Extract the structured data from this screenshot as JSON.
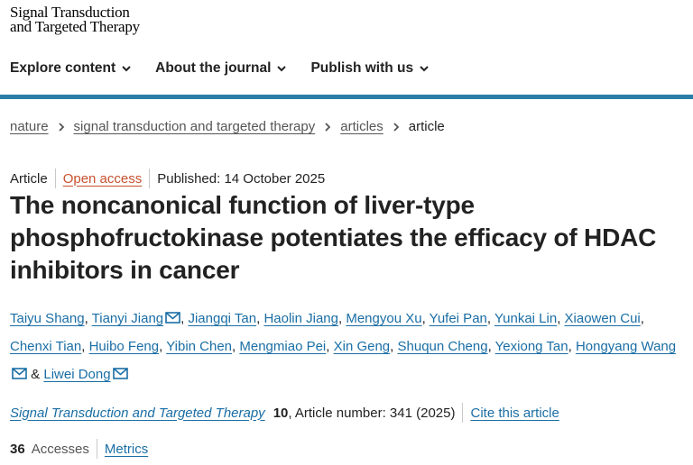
{
  "brand": {
    "line1": "Signal Transduction",
    "line2": "and Targeted Therapy"
  },
  "nav": [
    {
      "label": "Explore content"
    },
    {
      "label": "About the journal"
    },
    {
      "label": "Publish with us"
    }
  ],
  "breadcrumb": [
    {
      "label": "nature"
    },
    {
      "label": "signal transduction and targeted therapy"
    },
    {
      "label": "articles"
    },
    {
      "label": "article"
    }
  ],
  "meta": {
    "type": "Article",
    "access": "Open access",
    "published": "Published: 14 October 2025"
  },
  "title": "The noncanonical function of liver-type phosphofructokinase potentiates the efficacy of HDAC inhibitors in cancer",
  "authors": [
    {
      "name": "Taiyu Shang",
      "mail": false
    },
    {
      "name": "Tianyi Jiang",
      "mail": true
    },
    {
      "name": "Jiangqi Tan",
      "mail": false
    },
    {
      "name": "Haolin Jiang",
      "mail": false
    },
    {
      "name": "Mengyou Xu",
      "mail": false
    },
    {
      "name": "Yufei Pan",
      "mail": false
    },
    {
      "name": "Yunkai Lin",
      "mail": false
    },
    {
      "name": "Xiaowen Cui",
      "mail": false
    },
    {
      "name": "Chenxi Tian",
      "mail": false
    },
    {
      "name": "Huibo Feng",
      "mail": false
    },
    {
      "name": "Yibin Chen",
      "mail": false
    },
    {
      "name": "Mengmiao Pei",
      "mail": false
    },
    {
      "name": "Xin Geng",
      "mail": false
    },
    {
      "name": "Shuqun Cheng",
      "mail": false
    },
    {
      "name": "Yexiong Tan",
      "mail": false
    },
    {
      "name": "Hongyang Wang",
      "mail": true
    },
    {
      "name": "Liwei Dong",
      "mail": true
    }
  ],
  "author_separator": ",",
  "author_last_joiner": "&",
  "journal": {
    "name": "Signal Transduction and Targeted Therapy",
    "volume": "10",
    "article_number": ", Article number: 341 (2025)",
    "cite": "Cite this article"
  },
  "metrics": {
    "accesses_count": "36",
    "accesses_label": "Accesses",
    "metrics_link": "Metrics"
  },
  "colors": {
    "accent_bar": "#2a7fa8",
    "link": "#1a6ea5",
    "open_access": "#c7512e"
  },
  "icons": {
    "nav_dropdown": "chevron-down-icon",
    "breadcrumb_separator": "chevron-right-icon",
    "corresponding_author": "mail-icon"
  }
}
